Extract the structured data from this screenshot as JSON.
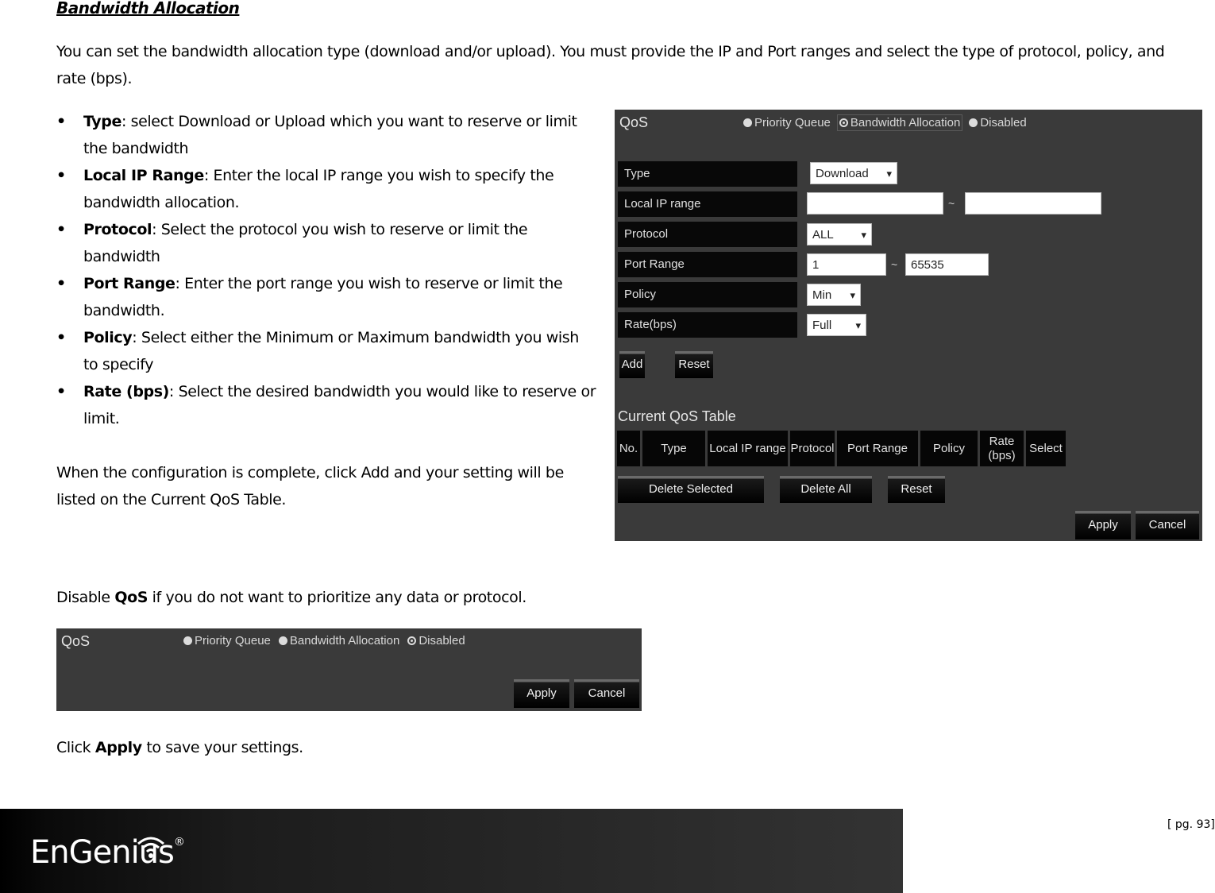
{
  "document": {
    "heading": "Bandwidth Allocation",
    "intro": "You can set the bandwidth allocation type (download and/or upload). You must provide the IP and Port ranges and select the type of protocol, policy, and rate (bps).",
    "bullets": [
      {
        "term": "Type",
        "text": ": select Download or Upload which you want to reserve or limit the bandwidth"
      },
      {
        "term": "Local IP Range",
        "text": ": Enter the local IP range you wish to specify the bandwidth allocation."
      },
      {
        "term": "Protocol",
        "text": ": Select the protocol you wish to reserve or limit the bandwidth"
      },
      {
        "term": "Port Range",
        "text": ": Enter the port range you wish to reserve or limit the bandwidth."
      },
      {
        "term": "Policy",
        "text": ": Select either the Minimum or Maximum bandwidth you wish to specify"
      },
      {
        "term": "Rate (bps)",
        "text": ": Select the desired bandwidth you would like to reserve or limit."
      }
    ],
    "complete_text": "When the configuration is complete, click Add and your setting will be listed on the Current QoS Table.",
    "disable_prefix": "Disable ",
    "disable_term": "QoS",
    "disable_suffix": " if you do not want to prioritize any data or protocol.",
    "click_prefix": "Click ",
    "click_term": "Apply",
    "click_suffix": " to save your settings."
  },
  "screenshot1": {
    "title": "QoS",
    "modes": [
      {
        "label": "Priority Queue",
        "checked": false
      },
      {
        "label": "Bandwidth Allocation",
        "checked": true
      },
      {
        "label": "Disabled",
        "checked": false
      }
    ],
    "fields": {
      "type_label": "Type",
      "type_value": "Download",
      "local_ip_label": "Local IP range",
      "local_ip_from": "",
      "local_ip_to": "",
      "protocol_label": "Protocol",
      "protocol_value": "ALL",
      "port_range_label": "Port Range",
      "port_from": "1",
      "port_to": "65535",
      "policy_label": "Policy",
      "policy_value": "Min",
      "rate_label": "Rate(bps)",
      "rate_value": "Full",
      "range_separator": "~"
    },
    "buttons": {
      "add": "Add",
      "reset": "Reset"
    },
    "table": {
      "title": "Current QoS Table",
      "columns": [
        "No.",
        "Type",
        "Local IP range",
        "Protocol",
        "Port Range",
        "Policy",
        "Rate (bps)",
        "Select"
      ]
    },
    "table_buttons": {
      "delete_selected": "Delete Selected",
      "delete_all": "Delete All",
      "reset": "Reset"
    },
    "footer_buttons": {
      "apply": "Apply",
      "cancel": "Cancel"
    }
  },
  "screenshot2": {
    "title": "QoS",
    "modes": [
      {
        "label": "Priority Queue",
        "checked": false
      },
      {
        "label": "Bandwidth Allocation",
        "checked": false
      },
      {
        "label": "Disabled",
        "checked": true
      }
    ],
    "footer_buttons": {
      "apply": "Apply",
      "cancel": "Cancel"
    }
  },
  "footer": {
    "brand": "EnGenius",
    "registered": "®",
    "page": "[ pg. 93]"
  }
}
